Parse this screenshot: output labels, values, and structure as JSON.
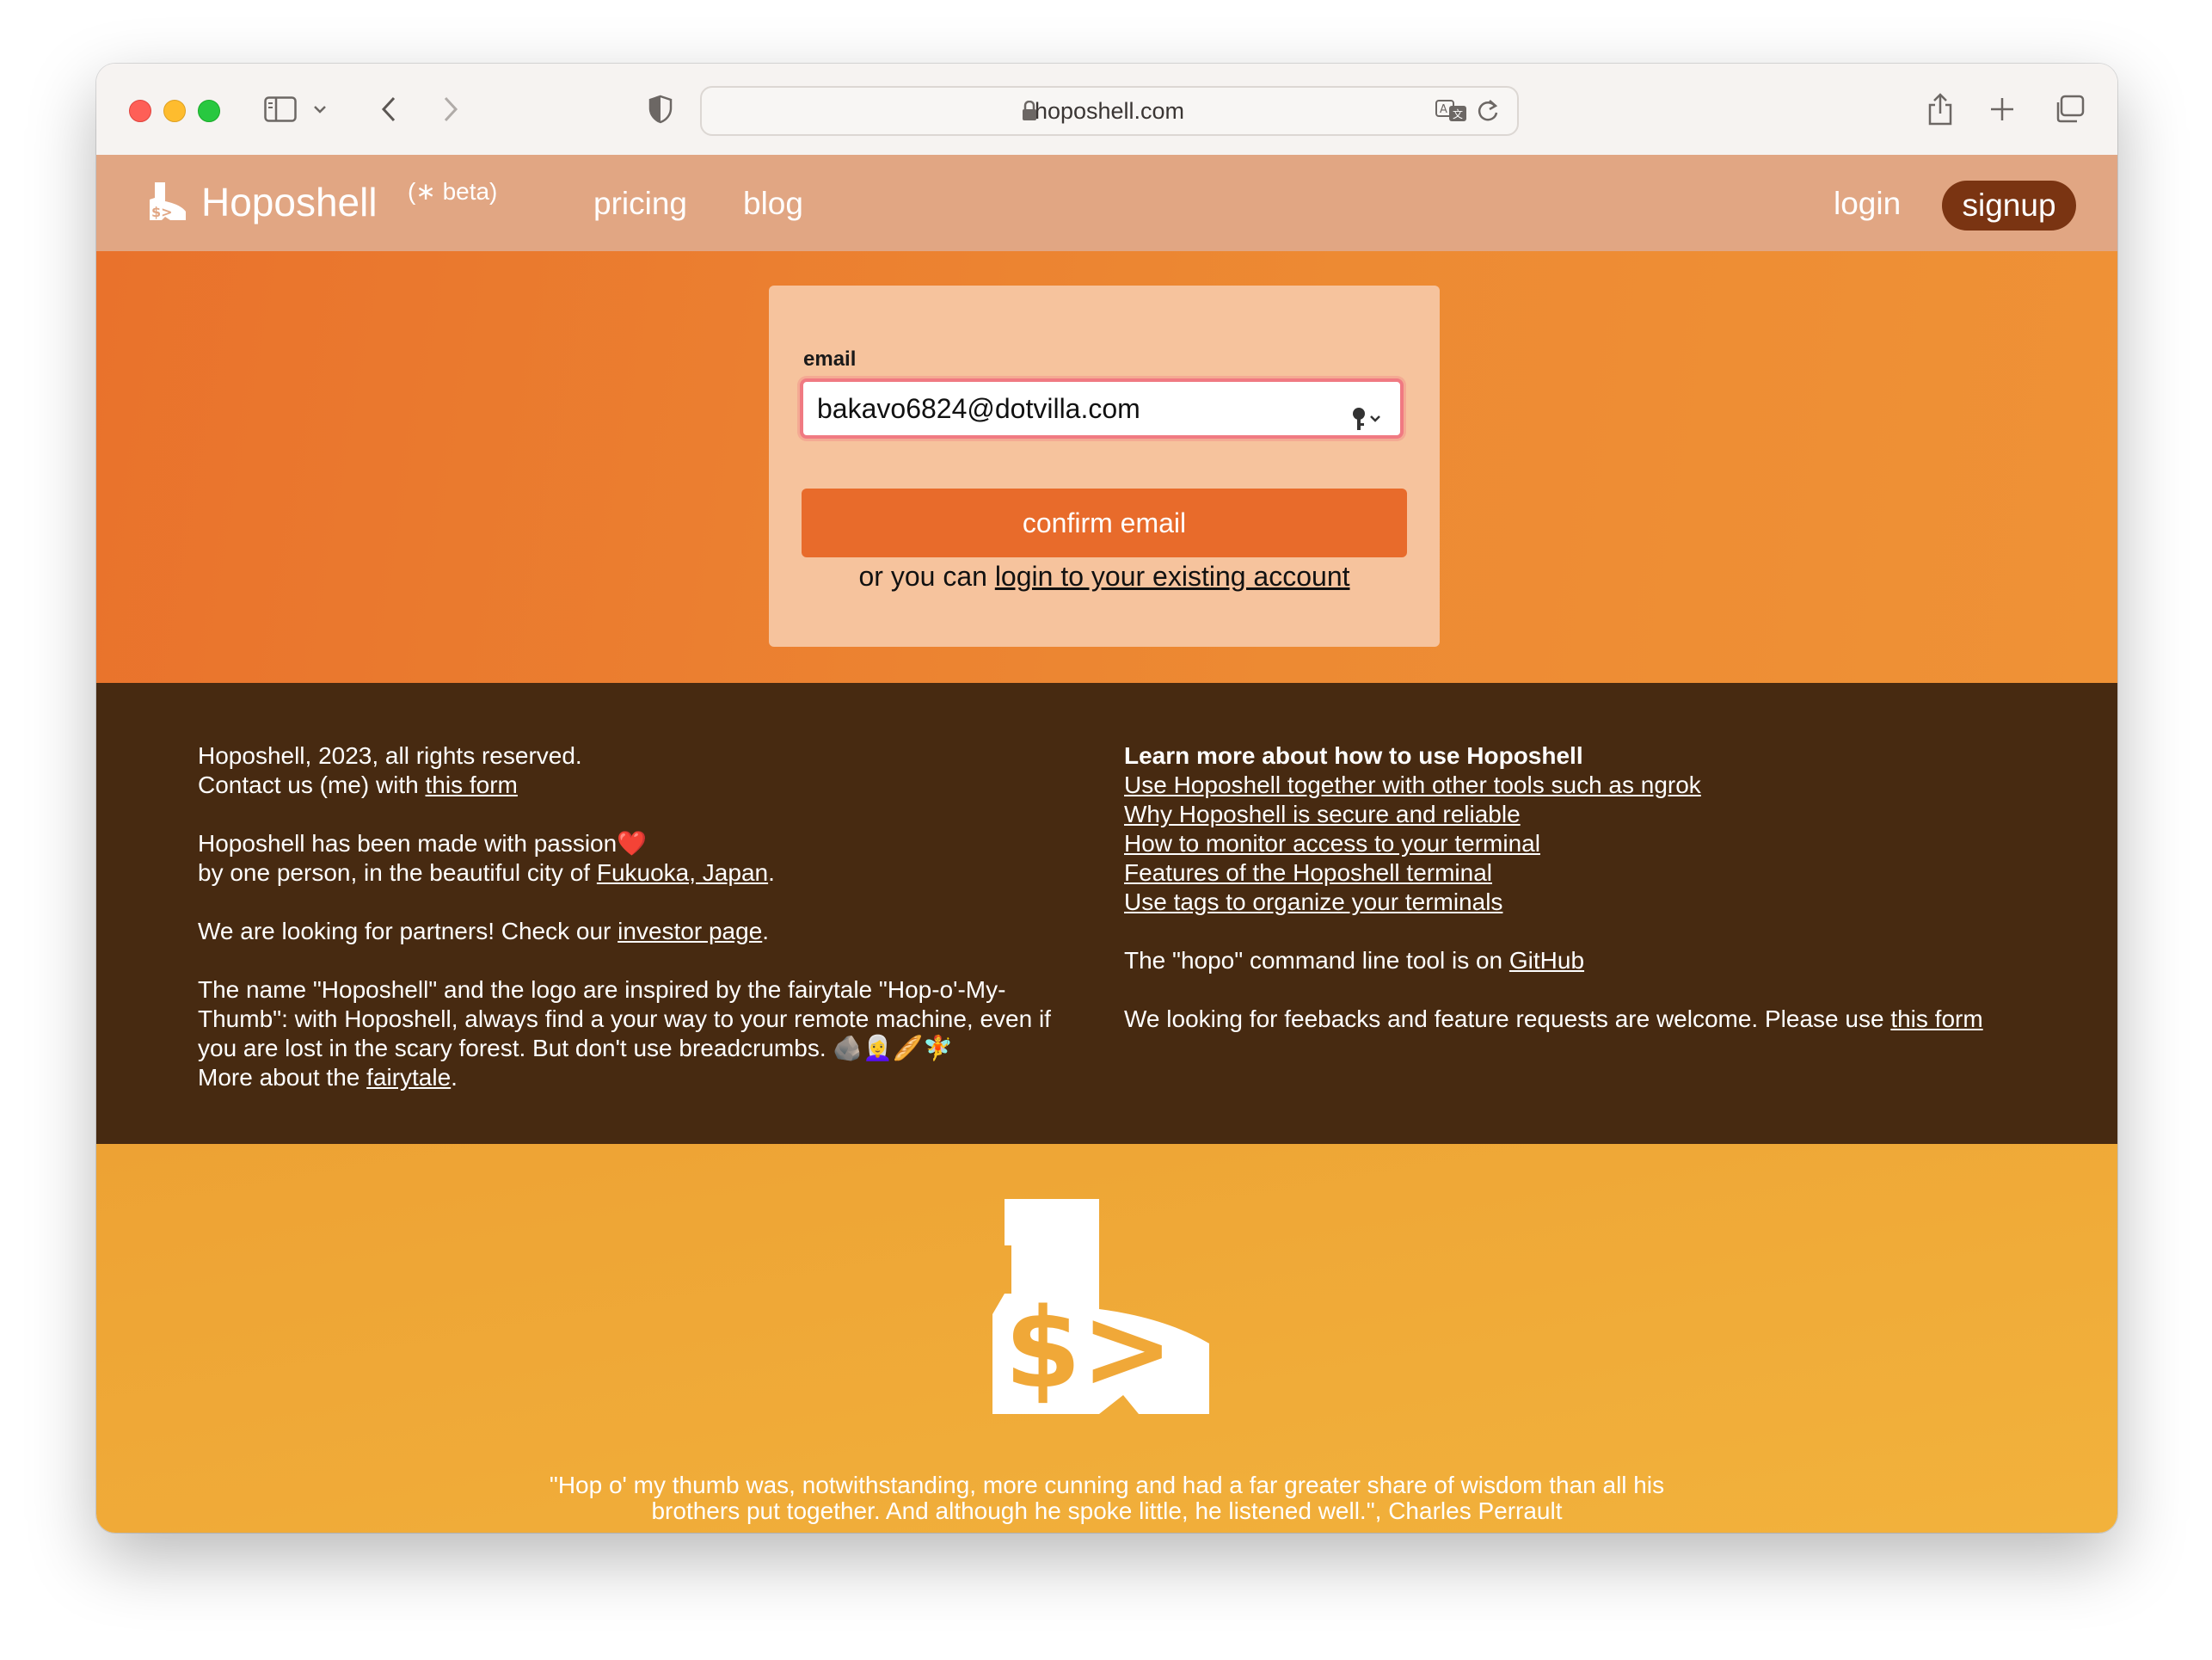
{
  "browser": {
    "url": "hoposhell.com"
  },
  "nav": {
    "brand": "Hoposhell",
    "beta": "(∗ beta)",
    "pricing": "pricing",
    "blog": "blog",
    "login": "login",
    "signup": "signup"
  },
  "form": {
    "email_label": "email",
    "email_value": "bakavo6824@dotvilla.com",
    "confirm_button": "confirm email",
    "alt_prefix": "or you can ",
    "alt_link": "login to your existing account"
  },
  "footer": {
    "left": {
      "copyright": "Hoposhell, 2023, all rights reserved.",
      "contact_prefix": "Contact us (me) with ",
      "contact_link": "this form",
      "passion": "Hoposhell has been made with passion",
      "heart": "❤️",
      "city_prefix": "by one person, in the beautiful city of ",
      "city_link": "Fukuoka, Japan",
      "city_suffix": ".",
      "partners_prefix": "We are looking for partners! Check our ",
      "partners_link": "investor page",
      "partners_suffix": ".",
      "name_text": "The name \"Hoposhell\" and the logo are inspired by the fairytale \"Hop-o'-My-Thumb\": with Hoposhell, always find a your way to your remote machine, even if you are lost in the scary forest. But don't use breadcrumbs.",
      "emojis": "🪨👩‍🦳🥖🧚",
      "more_prefix": "More about the ",
      "more_link": "fairytale",
      "more_suffix": "."
    },
    "right": {
      "title": "Learn more about how to use Hoposhell",
      "links": [
        "Use Hoposhell together with other tools such as ngrok",
        "Why Hoposhell is secure and reliable",
        "How to monitor access to your terminal",
        "Features of the Hoposhell terminal",
        "Use tags to organize your terminals"
      ],
      "cli_prefix": "The \"hopo\" command line tool is on ",
      "cli_link": "GitHub",
      "feedback_prefix": "We looking for feebacks and feature requests are welcome. Please use ",
      "feedback_link": "this form"
    }
  },
  "quote": {
    "line1": "\"Hop o' my thumb was, notwithstanding, more cunning and had a far greater share of wisdom than all his",
    "line2": "brothers put together. And although he spoke little, he listened well.\", Charles Perrault"
  },
  "logo_text": "$>",
  "colors": {
    "nav": "#e1a683",
    "hero": "#ec8131",
    "card": "#f6c39d",
    "button": "#e86b2b",
    "signup": "#7a3412",
    "footer": "#472a11",
    "bottom": "#f0aa38"
  }
}
